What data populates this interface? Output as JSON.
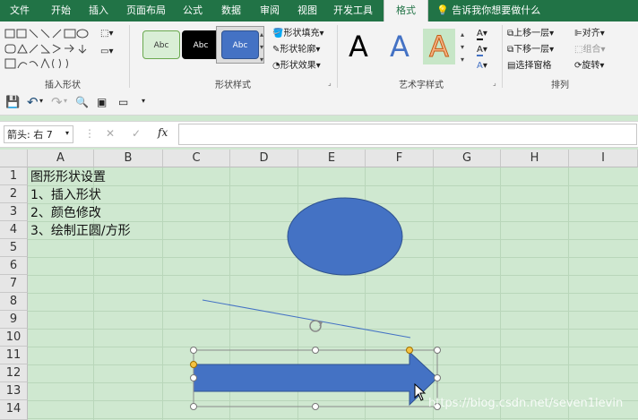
{
  "menu": {
    "tabs": [
      {
        "label": "文件"
      },
      {
        "label": "开始"
      },
      {
        "label": "插入"
      },
      {
        "label": "页面布局"
      },
      {
        "label": "公式"
      },
      {
        "label": "数据"
      },
      {
        "label": "审阅"
      },
      {
        "label": "视图"
      },
      {
        "label": "开发工具"
      },
      {
        "label": "格式",
        "active": true
      }
    ],
    "tell_me": "告诉我你想要做什么"
  },
  "ribbon": {
    "groups": {
      "insert_shapes": "插入形状",
      "shape_styles": "形状样式",
      "wordart_styles": "艺术字样式",
      "arrange": "排列"
    },
    "style_samples": [
      "Abc",
      "Abc",
      "Abc"
    ],
    "shape_fill": "形状填充",
    "shape_outline": "形状轮廓",
    "shape_effects": "形状效果",
    "wordart_letter": "A",
    "bring_forward": "上移一层",
    "send_backward": "下移一层",
    "selection_pane": "选择窗格",
    "align": "对齐",
    "group": "组合",
    "rotate": "旋转"
  },
  "formula_bar": {
    "name_box": "箭头: 右 7",
    "fx": "fx",
    "cancel": "✕",
    "enter": "✓",
    "content": ""
  },
  "sheet": {
    "columns": [
      "A",
      "B",
      "C",
      "D",
      "E",
      "F",
      "G",
      "H",
      "I"
    ],
    "rows": [
      "1",
      "2",
      "3",
      "4",
      "5",
      "6",
      "7",
      "8",
      "9",
      "10",
      "11",
      "12",
      "13",
      "14"
    ],
    "cells": {
      "A1": "图形形状设置",
      "A2": "1、插入形状",
      "A3": "2、颜色修改",
      "A4": "3、绘制正圆/方形"
    }
  },
  "colors": {
    "accent": "#217346",
    "shape_fill": "#4472c4",
    "sheet_bg": "#cfe8d0"
  },
  "watermark": "https://blog.csdn.net/seven1levin"
}
